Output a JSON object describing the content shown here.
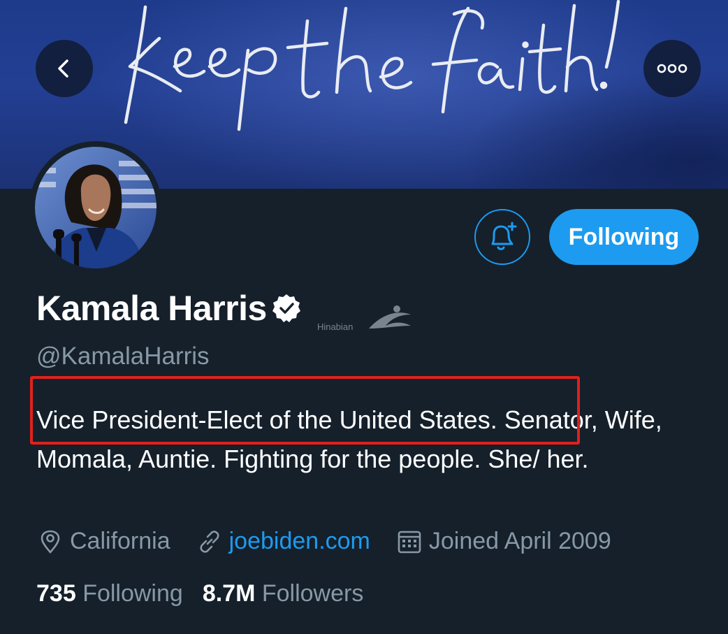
{
  "banner": {
    "script_text": "keep the faith!"
  },
  "icons": {
    "back": "chevron-left-icon",
    "more": "more-horizontal-icon",
    "notify": "bell-plus-icon",
    "verified": "verified-badge-icon",
    "location": "location-pin-icon",
    "link": "link-icon",
    "calendar": "calendar-icon"
  },
  "colors": {
    "background": "#15202b",
    "accent": "#1d9bf0",
    "muted": "#8899a6",
    "highlight": "#e0211c"
  },
  "profile": {
    "name": "Kamala Harris",
    "handle": "@KamalaHarris",
    "bio_highlighted": "Vice President-Elect of the United States.",
    "bio_rest": " Senator, Wife, Momala, Auntie. Fighting for the people. She/ her.",
    "location": "California",
    "website": "joebiden.com",
    "joined": "Joined April 2009"
  },
  "actions": {
    "following_label": "Following"
  },
  "stats": {
    "following_count": "735",
    "following_label": "Following",
    "followers_count": "8.7M",
    "followers_label": "Followers"
  },
  "watermark": {
    "text": "Hinabian"
  }
}
